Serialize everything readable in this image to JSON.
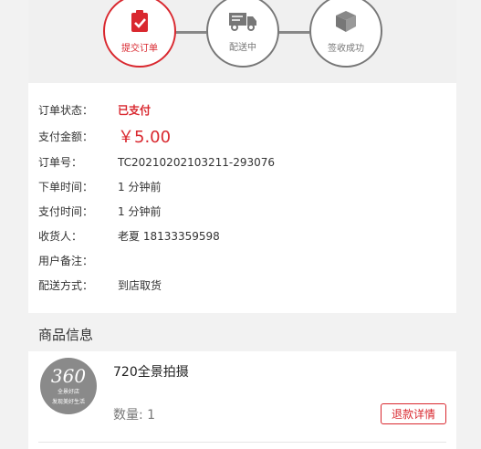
{
  "progress": {
    "steps": [
      {
        "label": "提交订单",
        "icon": "clipboard-check-icon",
        "active": true
      },
      {
        "label": "配送中",
        "icon": "truck-icon",
        "active": false
      },
      {
        "label": "签收成功",
        "icon": "box-icon",
        "active": false
      }
    ]
  },
  "order": {
    "status_label": "订单状态：",
    "status_value": "已支付",
    "amount_label": "支付金额：",
    "amount_value": "￥5.00",
    "number_label": "订单号：",
    "number_value": "TC20210202103211-293076",
    "order_time_label": "下单时间：",
    "order_time_value": "1 分钟前",
    "pay_time_label": "支付时间：",
    "pay_time_value": "1 分钟前",
    "receiver_label": "收货人：",
    "receiver_value": "老夏 18133359598",
    "remark_label": "用户备注：",
    "remark_value": "",
    "delivery_label": "配送方式：",
    "delivery_value": "到店取货"
  },
  "goods": {
    "section_title": "商品信息",
    "thumb_text": "360",
    "thumb_brand": "全景好店",
    "thumb_tagline": "发现美好生活",
    "name": "720全景拍摄",
    "qty_text": "数量:  1",
    "refund_label": "退款详情"
  },
  "colors": {
    "accent": "#d9282f",
    "muted": "#777777"
  }
}
